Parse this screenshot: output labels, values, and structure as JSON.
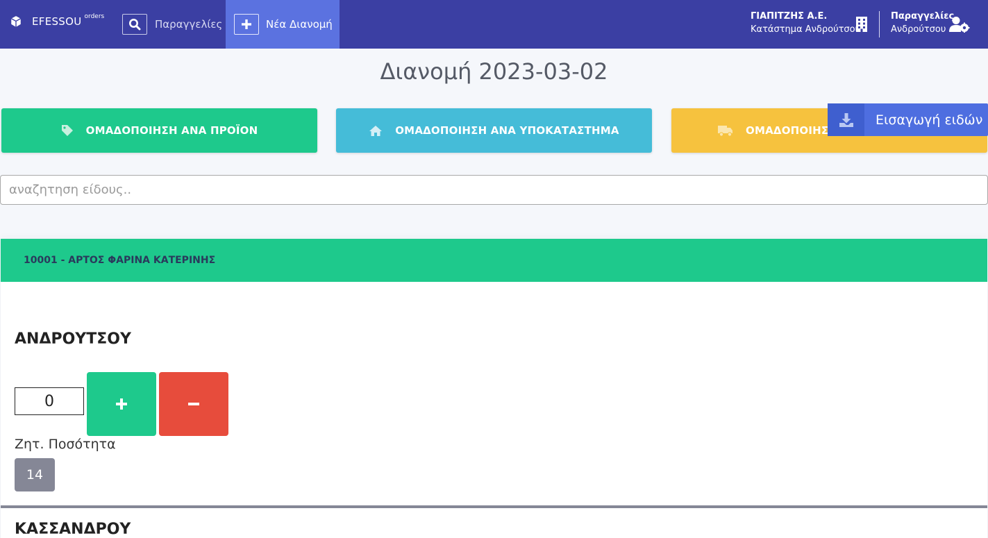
{
  "navbar": {
    "brand_name": "EFESSOU",
    "brand_sup": "orders",
    "orders_label": "Παραγγελίες",
    "new_distribution_label": "Νέα Διανομή",
    "company_name": "ΓΙΑΠΙΤΖΗΣ Α.Ε.",
    "company_store": "Κατάστημα Ανδρούτσου",
    "user_title": "Παραγγελίες",
    "user_sub": "Ανδρούτσου"
  },
  "page_title": "Διανομή 2023-03-02",
  "grouping": {
    "by_product": "ΟΜΑΔΟΠΟΙΗΣΗ ΑΝΑ ΠΡΟΪΟΝ",
    "by_store": "ΟΜΑΔΟΠΟΙΗΣΗ ΑΝΑ ΥΠΟΚΑΤΑΣΤΗΜΑ",
    "by_route": "ΟΜΑΔΟΠΟΙΗΣΗ"
  },
  "import_button": "Εισαγωγή ειδών",
  "search": {
    "placeholder": "αναζητηση είδους.."
  },
  "product": {
    "header": "10001 - ΑΡΤΟΣ ΦΑΡΙΝΑ ΚΑΤΕΡΙΝΗΣ",
    "stores": [
      {
        "name": "ΑΝΔΡΟΥΤΣΟΥ",
        "quantity": "0",
        "requested_label": "Ζητ. Ποσότητα",
        "requested": "14"
      },
      {
        "name": "ΚΑΣΣΑΝΔΡΟΥ"
      }
    ]
  },
  "colors": {
    "navbar": "#3b3fa3",
    "nav_active": "#5b72e0",
    "success": "#1ec98c",
    "info": "#45bcd8",
    "warning": "#f6c23e",
    "danger": "#e74c3c",
    "primary": "#4e6ee0",
    "secondary": "#858796"
  },
  "icons": [
    "cube-icon",
    "search-icon",
    "plus-icon",
    "building-icon",
    "user-gear-icon",
    "tag-icon",
    "home-icon",
    "truck-icon",
    "download-icon"
  ]
}
